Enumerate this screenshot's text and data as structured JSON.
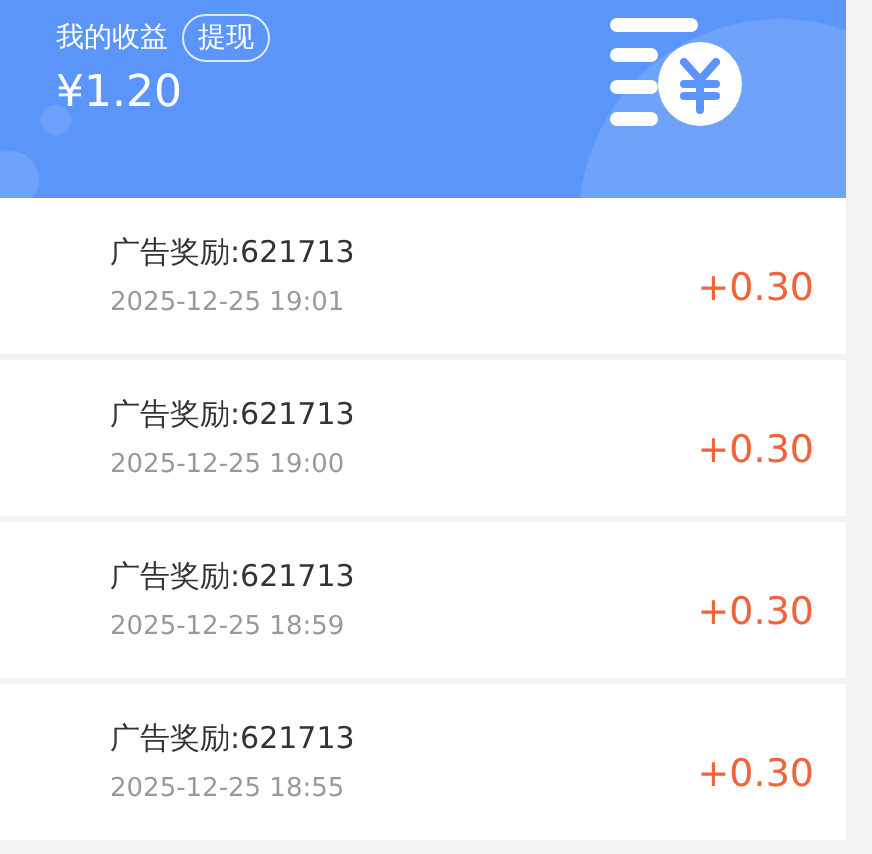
{
  "header": {
    "title": "我的收益",
    "withdraw_button": "提现",
    "balance": "¥1.20"
  },
  "records": [
    {
      "title": "广告奖励:621713",
      "time": "2025-12-25 19:01",
      "amount": "+0.30"
    },
    {
      "title": "广告奖励:621713",
      "time": "2025-12-25 19:00",
      "amount": "+0.30"
    },
    {
      "title": "广告奖励:621713",
      "time": "2025-12-25 18:59",
      "amount": "+0.30"
    },
    {
      "title": "广告奖励:621713",
      "time": "2025-12-25 18:55",
      "amount": "+0.30"
    }
  ]
}
